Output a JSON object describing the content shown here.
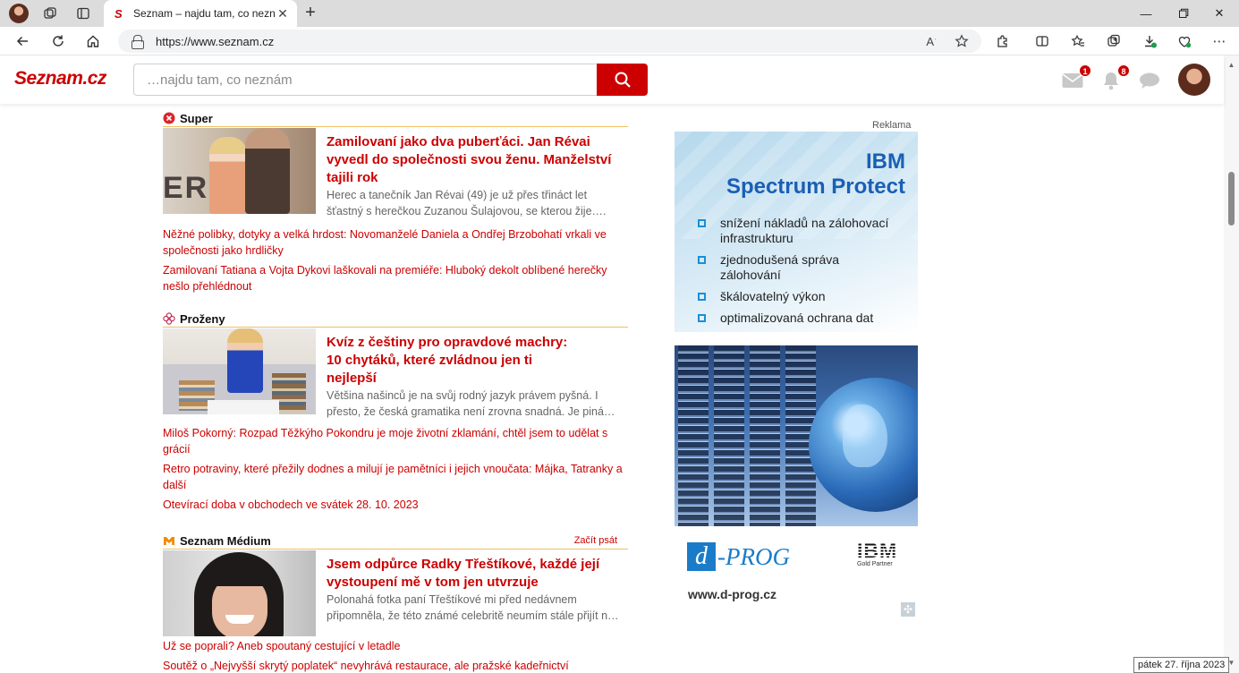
{
  "browser": {
    "tab_title": "Seznam – najdu tam, co neznám",
    "url": "https://www.seznam.cz",
    "icons": [
      "profile-icon",
      "workspaces-icon",
      "tab-actions-icon",
      "back-icon",
      "refresh-icon",
      "home-icon",
      "lock-icon",
      "read-aloud-icon",
      "favorite-star-icon",
      "extensions-icon",
      "split-screen-icon",
      "favorites-icon",
      "collections-icon",
      "downloads-icon",
      "browser-essentials-icon",
      "more-icon"
    ]
  },
  "header": {
    "logo": "Seznam.cz",
    "search_placeholder": "…najdu tam, co neznám",
    "mail_badge": "1",
    "notif_badge": "8"
  },
  "sections": [
    {
      "title": "Super",
      "icon": "super-icon",
      "lead": {
        "title": "Zamilovaní jako dva puberťáci. Jan Révai vyvedl do společnosti svou ženu. Manželství tajili rok",
        "desc": "Herec a tanečník Jan Révai (49) je už přes třináct let šťastný s herečkou Zuzanou Šulajovou, se kterou žije…."
      },
      "links": [
        "Něžné polibky, dotyky a velká hrdost: Novomanželé Daniela a Ondřej Brzobohatí vrkali ve společnosti jako hrdličky",
        "Zamilovaní Tatiana a Vojta Dykovi laškovali na premiéře: Hluboký dekolt oblíbené herečky nešlo přehlédnout"
      ]
    },
    {
      "title": "Proženy",
      "icon": "flower-icon",
      "lead": {
        "title": "Kvíz z češtiny pro opravdové machry: 10 chytáků, které zvládnou jen ti nejlepší",
        "desc": "Většina našinců je na svůj rodný jazyk právem pyšná. I přesto, že česká gramatika není zrovna snadná. Je piná…"
      },
      "links": [
        "Miloš Pokorný: Rozpad Těžkýho Pokondru je moje životní zklamání, chtěl jsem to udělat s grácií",
        "Retro potraviny, které přežily dodnes a milují je pamětníci i jejich vnoučata: Májka, Tatranky a další",
        "Otevírací doba v obchodech ve svátek 28. 10. 2023"
      ]
    },
    {
      "title": "Seznam Médium",
      "icon": "medium-m-icon",
      "more": "Začít psát",
      "lead": {
        "title": "Jsem odpůrce Radky Třeštíkové, každé její vystoupení mě v tom jen utvrzuje",
        "desc": "Polonahá fotka paní Třeštíkové mi před nedávnem připomněla, že této známé celebritě neumím stále přijít n…"
      },
      "links": [
        "Už se poprali? Aneb spoutaný cestující v letadle",
        "Soutěž o „Nejvyšší skrytý poplatek“ nevyhrává restaurace, ale pražské kadeřnictví"
      ]
    }
  ],
  "ad": {
    "label": "Reklama",
    "brand_line1": "IBM",
    "brand_line2": "Spectrum Protect",
    "bullets": [
      "snížení nákladů na zálohovací infrastrukturu",
      "zjednodušená správa zálohování",
      "škálovatelný výkon",
      "optimalizovaná ochrana dat"
    ],
    "partner_letter": "d",
    "partner_name": "-PROG",
    "ibm_logo": "IBM",
    "ibm_gold": "Gold Partner",
    "url": "www.d-prog.cz"
  },
  "tooltip": "pátek 27. října 2023",
  "colors": {
    "accent": "#cc0000",
    "section_rule": "#f0c060",
    "ibm_blue": "#1a5fb4"
  }
}
